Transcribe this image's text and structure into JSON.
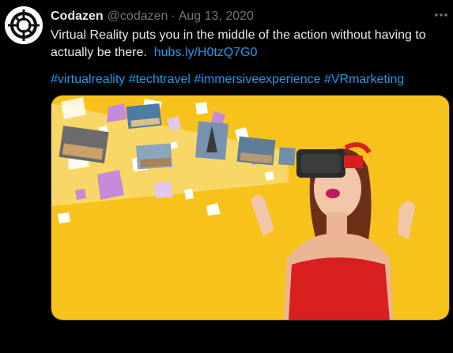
{
  "tweet": {
    "display_name": "Codazen",
    "handle": "@codazen",
    "separator": "·",
    "date": "Aug 13, 2020",
    "text_line1": "Virtual Reality puts you in the middle of the action without having to",
    "text_line2": "actually be there.",
    "link_text": "hubs.ly/H0tzQ7G0",
    "hashtags": [
      "#virtualreality",
      "#techtravel",
      "#immersiveexperience",
      "#VRmarketing"
    ]
  },
  "icons": {
    "avatar": "codazen-logo-icon",
    "more": "more-options-icon"
  },
  "colors": {
    "background": "#000000",
    "text": "#e7e9ea",
    "muted": "#71767b",
    "link": "#1d9bf0",
    "media_background": "#f7c21b",
    "dress": "#d91f1f",
    "headset": "#2b2b2b"
  }
}
